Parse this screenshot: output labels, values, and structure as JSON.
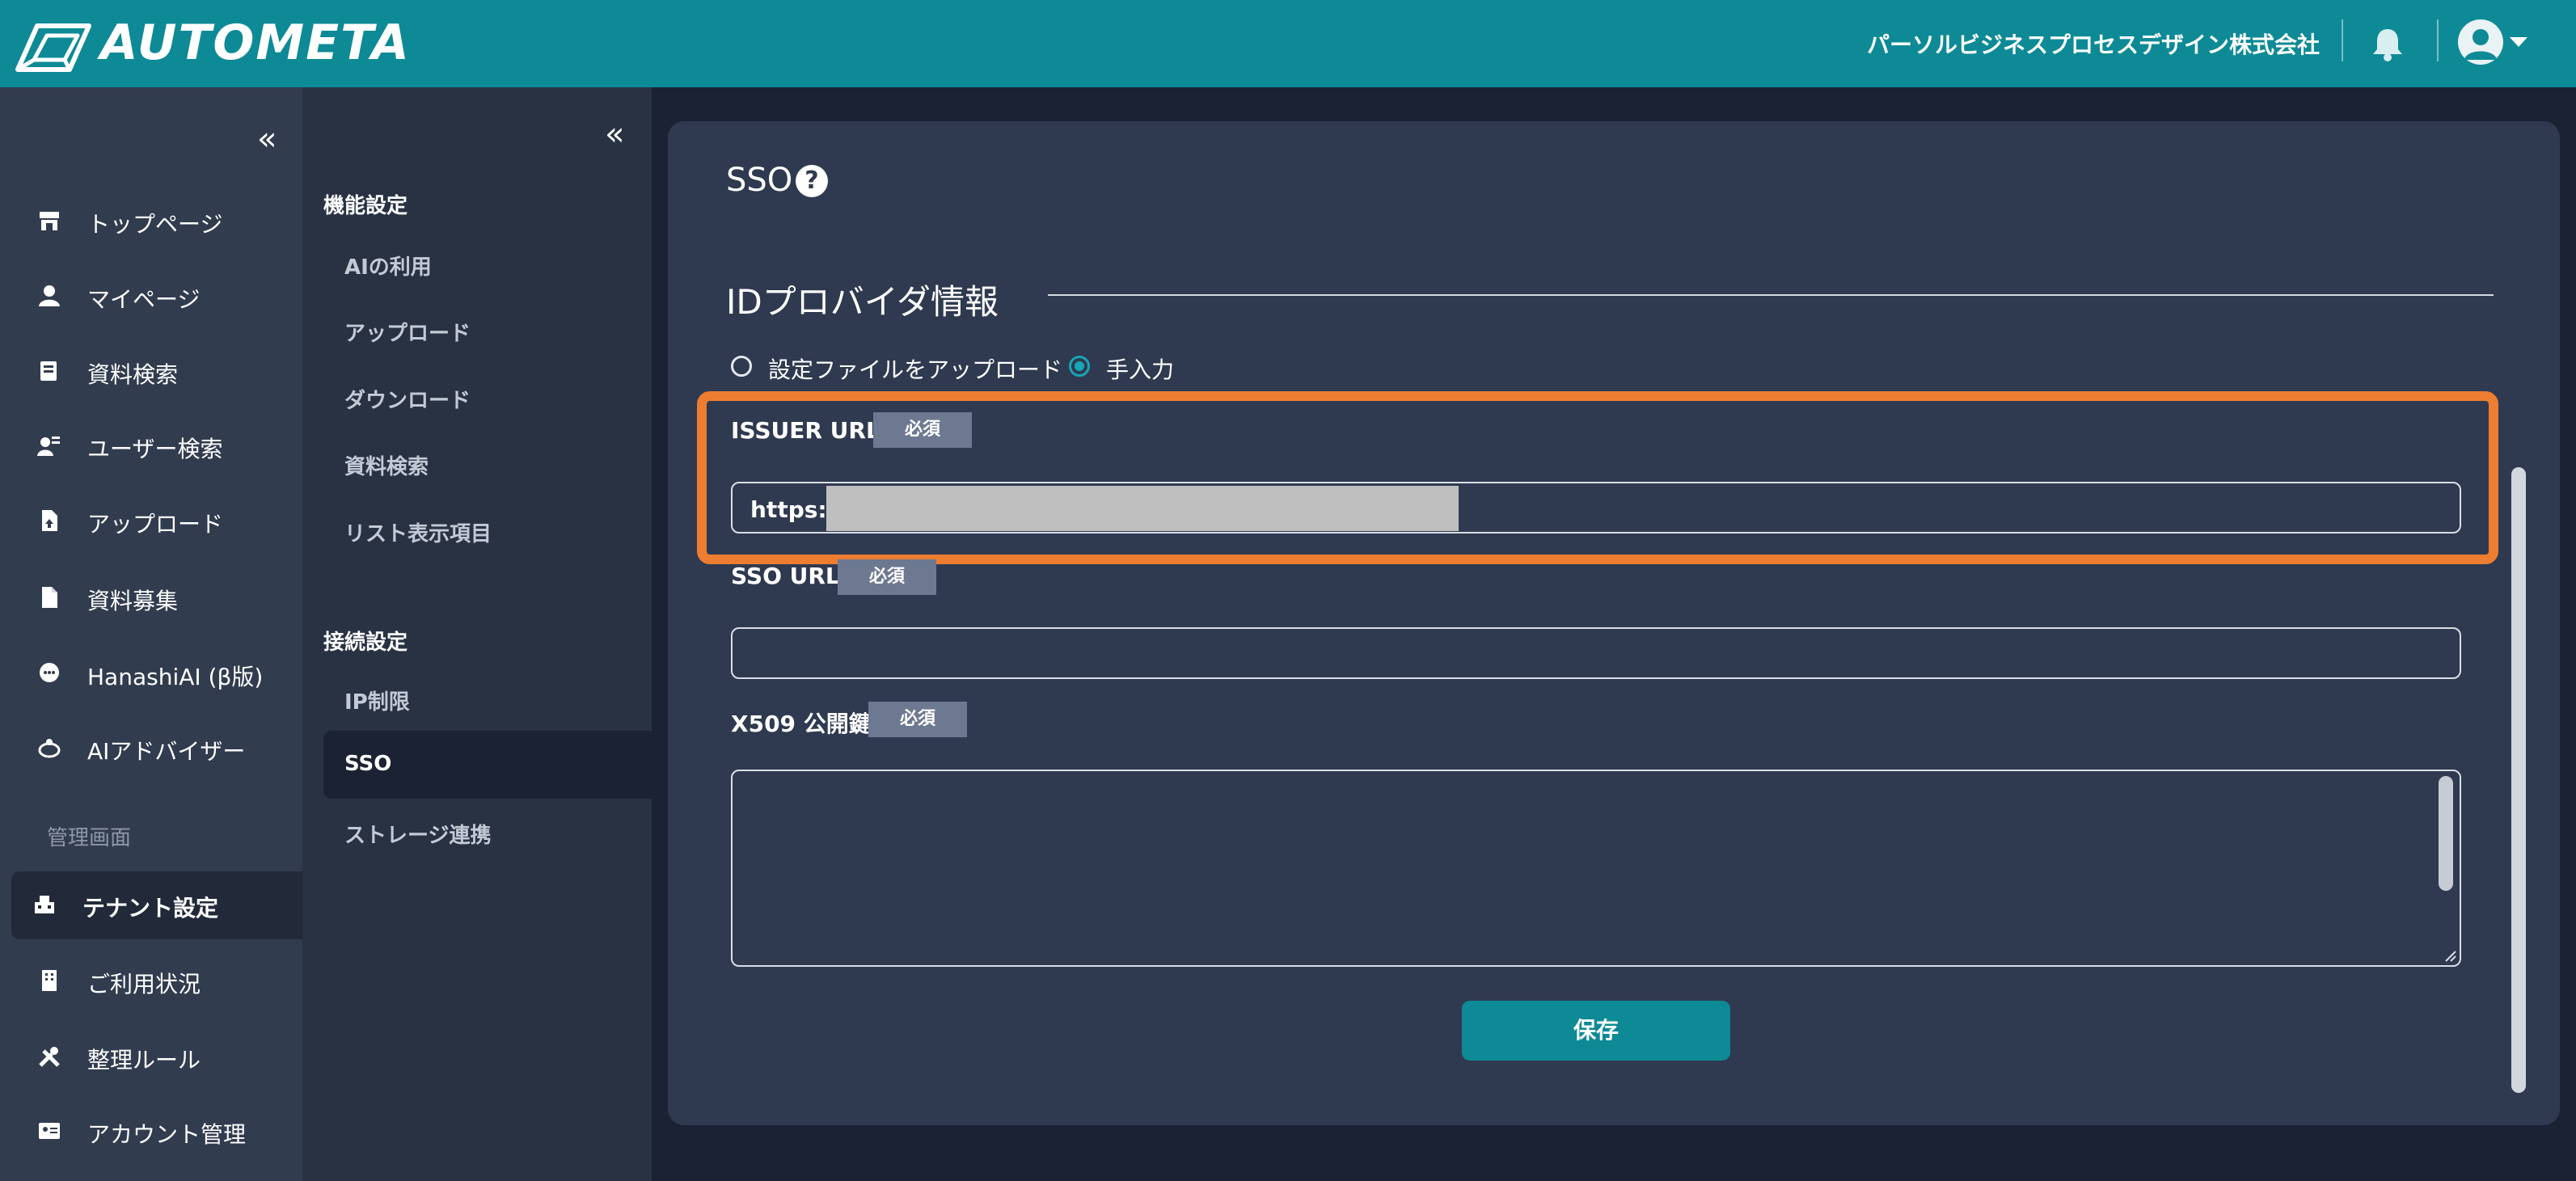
{
  "header": {
    "logo": "AUTOMETA",
    "company": "パーソルビジネスプロセスデザイン株式会社",
    "icons": [
      "bell-icon",
      "user-avatar-icon",
      "caret-down-icon"
    ]
  },
  "sidebar": {
    "collapse_label": "«",
    "items": [
      {
        "label": "トップページ",
        "icon": "store-icon"
      },
      {
        "label": "マイページ",
        "icon": "person-icon"
      },
      {
        "label": "資料検索",
        "icon": "document-search-icon"
      },
      {
        "label": "ユーザー検索",
        "icon": "user-search-icon"
      },
      {
        "label": "アップロード",
        "icon": "upload-file-icon"
      },
      {
        "label": "資料募集",
        "icon": "file-icon"
      },
      {
        "label": "HanashiAI (β版)",
        "icon": "chat-icon"
      },
      {
        "label": "AIアドバイザー",
        "icon": "robot-icon"
      }
    ],
    "admin_section": "管理画面",
    "admin_items": [
      {
        "label": "テナント設定",
        "icon": "building-icon",
        "active": true
      },
      {
        "label": "ご利用状況",
        "icon": "office-icon"
      },
      {
        "label": "整理ルール",
        "icon": "tools-icon"
      },
      {
        "label": "アカウント管理",
        "icon": "id-card-icon"
      }
    ]
  },
  "subnav": {
    "collapse_label": "«",
    "group1_title": "機能設定",
    "group1_items": [
      "AIの利用",
      "アップロード",
      "ダウンロード",
      "資料検索",
      "リスト表示項目"
    ],
    "group2_title": "接続設定",
    "group2_items": [
      "IP制限",
      "SSO",
      "ストレージ連携"
    ],
    "active_item": "SSO"
  },
  "main": {
    "title": "SSO",
    "help_label": "?",
    "section_title": "IDプロバイダ情報",
    "radio_options": [
      "設定ファイルをアップロード",
      "手入力"
    ],
    "radio_selected": "手入力",
    "fields": {
      "issuer": {
        "label": "ISSUER URL",
        "required": "必須",
        "value": "https://"
      },
      "sso": {
        "label": "SSO URL",
        "required": "必須",
        "value": ""
      },
      "x509": {
        "label": "X509 公開鍵",
        "required": "必須",
        "value": ""
      }
    },
    "save_label": "保存",
    "accent_color": "#0d8a96",
    "highlight_color": "#ed7d31"
  }
}
